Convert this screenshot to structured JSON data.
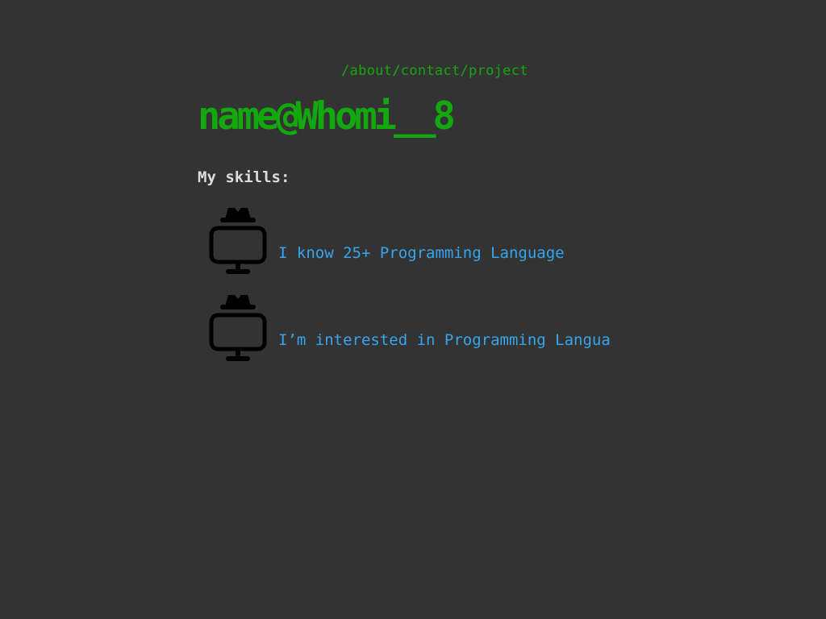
{
  "nav": {
    "about": "/about",
    "contact": "/contact",
    "project": "/project"
  },
  "header": {
    "title": "name@Whomi__8"
  },
  "skills": {
    "heading": "My skills:",
    "items": [
      {
        "icon": "hacker-computer-icon",
        "text": "I know 25+ Programming Language"
      },
      {
        "icon": "hacker-computer-icon",
        "text": "I’m interested in Programming Langua"
      }
    ]
  },
  "colors": {
    "background": "#333333",
    "accent_green": "#14a80f",
    "text_blue": "#35a6ee",
    "heading_text": "#dcdcdc",
    "icon": "#000000"
  }
}
